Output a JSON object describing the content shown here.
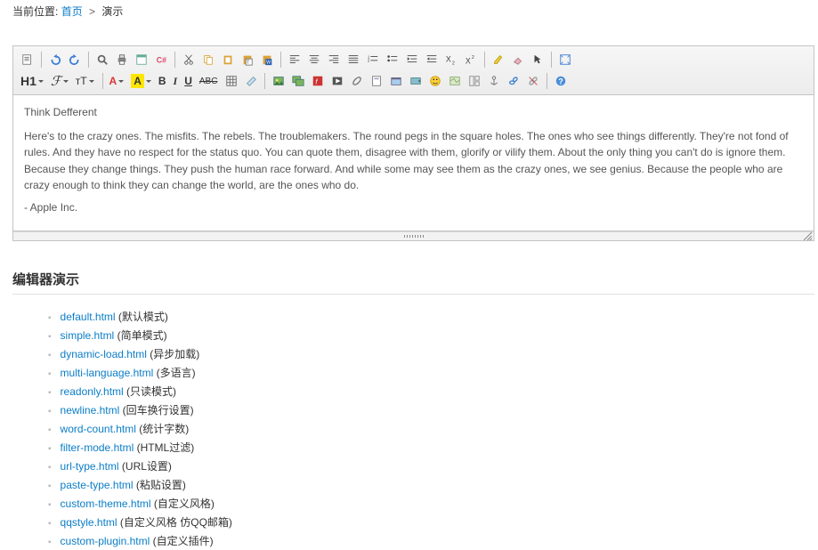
{
  "breadcrumb": {
    "label": "当前位置:",
    "home": "首页",
    "sep": ">",
    "current": "演示"
  },
  "editor": {
    "row1": {
      "source": "source-icon",
      "undo": "undo-icon",
      "redo": "redo-icon",
      "preview": "preview-icon",
      "print": "print-icon",
      "template": "template-icon",
      "codeformat": "codeformat-icon",
      "cut": "cut-icon",
      "copy": "copy-icon",
      "paste": "paste-icon",
      "pasteword": "pasteword-icon",
      "pasteplain": "pasteplain-icon",
      "selectall": "selectall-icon",
      "alignleft": "alignleft-icon",
      "aligncenter": "aligncenter-icon",
      "alignright": "alignright-icon",
      "alignjustify": "alignjustify-icon",
      "orderedlist": "orderedlist-icon",
      "unorderedlist": "unorderedlist-icon",
      "indent": "indent-icon",
      "outdent": "outdent-icon",
      "subscript": "subscript-icon",
      "superscript": "superscript-icon",
      "highlighter": "highlighter-icon",
      "eraser": "eraser-icon",
      "pointer": "pointer-icon",
      "fullscreen": "fullscreen-icon"
    },
    "row2": {
      "h1": "H1",
      "font": "ℱ",
      "tt": "тT",
      "acolor": "A",
      "ahl": "A",
      "bold": "B",
      "italic": "I",
      "underline": "U",
      "strike": "ABC",
      "table": "table-icon",
      "format": "format-icon",
      "image": "image-icon",
      "multiimage": "multiimage-icon",
      "flash": "flash-icon",
      "media": "media-icon",
      "file": "file-icon",
      "attachment": "attachment-icon",
      "insertfile": "insertfile-icon",
      "more": "more-icon",
      "emoji": "emoji-icon",
      "map": "map-icon",
      "layout": "layout-icon",
      "anchor": "anchor-icon",
      "link": "link-icon",
      "unlink": "unlink-icon",
      "about": "about-icon"
    },
    "content": {
      "title": "Think Defferent",
      "body": "Here's to the crazy ones. The misfits. The rebels. The troublemakers. The round pegs in the square holes. The ones who see things differently. They're not fond of rules. And they have no respect for the status quo. You can quote them, disagree with them, glorify or vilify them. About the only thing you can't do is ignore them. Because they change things. They push the human race forward. And while some may see them as the crazy ones, we see genius. Because the people who are crazy enough to think they can change the world, are the ones who do.",
      "sign": "- Apple Inc."
    }
  },
  "section_title": "编辑器演示",
  "demos": [
    {
      "file": "default.html",
      "desc": "(默认模式)"
    },
    {
      "file": "simple.html",
      "desc": "(简单模式)"
    },
    {
      "file": "dynamic-load.html",
      "desc": "(异步加载)"
    },
    {
      "file": "multi-language.html",
      "desc": "(多语言)"
    },
    {
      "file": "readonly.html",
      "desc": "(只读模式)"
    },
    {
      "file": "newline.html",
      "desc": "(回车换行设置)"
    },
    {
      "file": "word-count.html",
      "desc": "(统计字数)"
    },
    {
      "file": "filter-mode.html",
      "desc": "(HTML过滤)"
    },
    {
      "file": "url-type.html",
      "desc": "(URL设置)"
    },
    {
      "file": "paste-type.html",
      "desc": "(粘贴设置)"
    },
    {
      "file": "custom-theme.html",
      "desc": "(自定义风格)"
    },
    {
      "file": "qqstyle.html",
      "desc": "(自定义风格 仿QQ邮箱)"
    },
    {
      "file": "custom-plugin.html",
      "desc": "(自定义插件)"
    }
  ]
}
